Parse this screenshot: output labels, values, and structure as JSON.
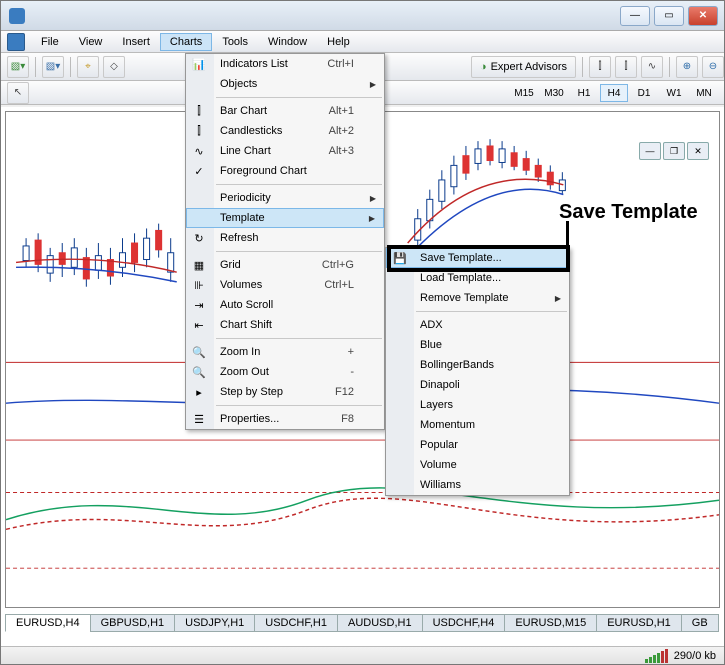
{
  "menubar": {
    "items": [
      "File",
      "View",
      "Insert",
      "Charts",
      "Tools",
      "Window",
      "Help"
    ],
    "active": 3
  },
  "toolbar1": {
    "expadv": "Expert Advisors"
  },
  "timeframes": {
    "items": [
      "M15",
      "M30",
      "H1",
      "H4",
      "D1",
      "W1",
      "MN"
    ],
    "active": "H4"
  },
  "charts_menu": {
    "items": [
      {
        "label": "Indicators List",
        "shortcut": "Ctrl+I",
        "icon": "📊"
      },
      {
        "label": "Objects",
        "arrow": true
      },
      {
        "sep": true
      },
      {
        "label": "Bar Chart",
        "shortcut": "Alt+1",
        "icon": "⫿"
      },
      {
        "label": "Candlesticks",
        "shortcut": "Alt+2",
        "icon": "⫿"
      },
      {
        "label": "Line Chart",
        "shortcut": "Alt+3",
        "icon": "∿"
      },
      {
        "label": "Foreground Chart",
        "check": true
      },
      {
        "sep": true
      },
      {
        "label": "Periodicity",
        "arrow": true
      },
      {
        "label": "Template",
        "arrow": true,
        "hover": true
      },
      {
        "label": "Refresh",
        "icon": "↻"
      },
      {
        "sep": true
      },
      {
        "label": "Grid",
        "shortcut": "Ctrl+G",
        "icon": "▦"
      },
      {
        "label": "Volumes",
        "shortcut": "Ctrl+L",
        "icon": "⊪"
      },
      {
        "label": "Auto Scroll",
        "icon": "⇥"
      },
      {
        "label": "Chart Shift",
        "icon": "⇤"
      },
      {
        "sep": true
      },
      {
        "label": "Zoom In",
        "shortcut": "+",
        "icon": "🔍"
      },
      {
        "label": "Zoom Out",
        "shortcut": "-",
        "icon": "🔍"
      },
      {
        "label": "Step by Step",
        "shortcut": "F12",
        "icon": "▸"
      },
      {
        "sep": true
      },
      {
        "label": "Properties...",
        "shortcut": "F8",
        "icon": "☰"
      }
    ]
  },
  "template_menu": {
    "items": [
      {
        "label": "Save Template...",
        "icon": "💾",
        "hover": true
      },
      {
        "label": "Load Template..."
      },
      {
        "label": "Remove Template",
        "arrow": true
      },
      {
        "sep": true
      },
      {
        "label": "ADX"
      },
      {
        "label": "Blue"
      },
      {
        "label": "BollingerBands"
      },
      {
        "label": "Dinapoli"
      },
      {
        "label": "Layers"
      },
      {
        "label": "Momentum"
      },
      {
        "label": "Popular"
      },
      {
        "label": "Volume"
      },
      {
        "label": "Williams"
      }
    ]
  },
  "tabs": {
    "items": [
      "EURUSD,H4",
      "GBPUSD,H1",
      "USDJPY,H1",
      "USDCHF,H1",
      "AUDUSD,H1",
      "USDCHF,H4",
      "EURUSD,M15",
      "EURUSD,H1",
      "GB"
    ],
    "active": 0
  },
  "status": {
    "kb": "290/0 kb"
  },
  "annotation": "Save Template"
}
